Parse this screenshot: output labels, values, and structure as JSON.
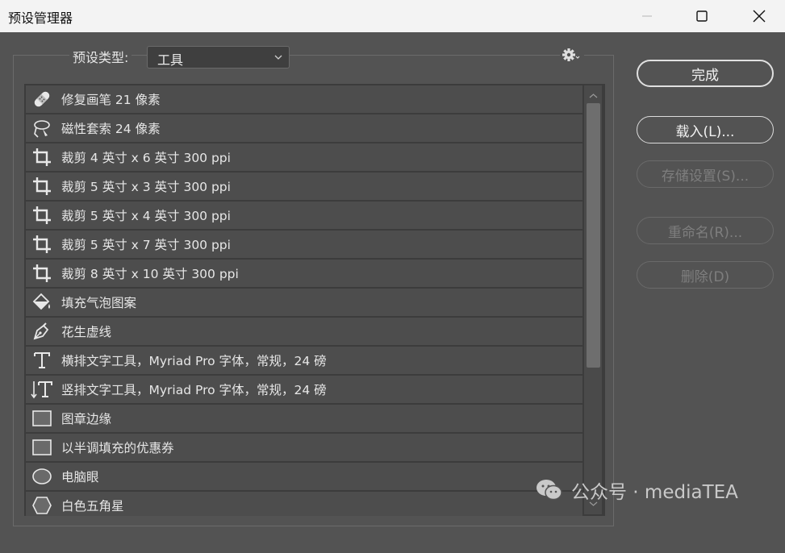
{
  "window": {
    "title": "预设管理器"
  },
  "preset_type": {
    "label": "预设类型:",
    "selected": "工具"
  },
  "presets": [
    {
      "label": "修复画笔 21 像素",
      "icon": "bandage-icon"
    },
    {
      "label": "磁性套索 24 像素",
      "icon": "magnetic-lasso-icon"
    },
    {
      "label": "裁剪 4 英寸 x 6 英寸 300 ppi",
      "icon": "crop-icon"
    },
    {
      "label": "裁剪 5 英寸 x 3 英寸 300 ppi",
      "icon": "crop-icon"
    },
    {
      "label": "裁剪 5 英寸 x 4 英寸 300 ppi",
      "icon": "crop-icon"
    },
    {
      "label": "裁剪 5 英寸 x 7 英寸 300 ppi",
      "icon": "crop-icon"
    },
    {
      "label": "裁剪 8 英寸 x 10 英寸 300 ppi",
      "icon": "crop-icon"
    },
    {
      "label": "填充气泡图案",
      "icon": "paint-bucket-icon"
    },
    {
      "label": "花生虚线",
      "icon": "pen-icon"
    },
    {
      "label": "横排文字工具，Myriad Pro 字体，常规，24 磅",
      "icon": "horizontal-type-icon"
    },
    {
      "label": "竖排文字工具，Myriad Pro 字体，常规，24 磅",
      "icon": "vertical-type-icon"
    },
    {
      "label": "图章边缘",
      "icon": "rectangle-icon"
    },
    {
      "label": "以半调填充的优惠券",
      "icon": "rectangle-icon"
    },
    {
      "label": "电脑眼",
      "icon": "ellipse-icon"
    },
    {
      "label": "白色五角星",
      "icon": "polygon-icon"
    }
  ],
  "buttons": {
    "done": "完成",
    "load": "载入(L)...",
    "save": "存储设置(S)...",
    "rename": "重命名(R)...",
    "delete": "删除(D)"
  },
  "watermark": {
    "text": "公众号 · mediaTEA"
  }
}
